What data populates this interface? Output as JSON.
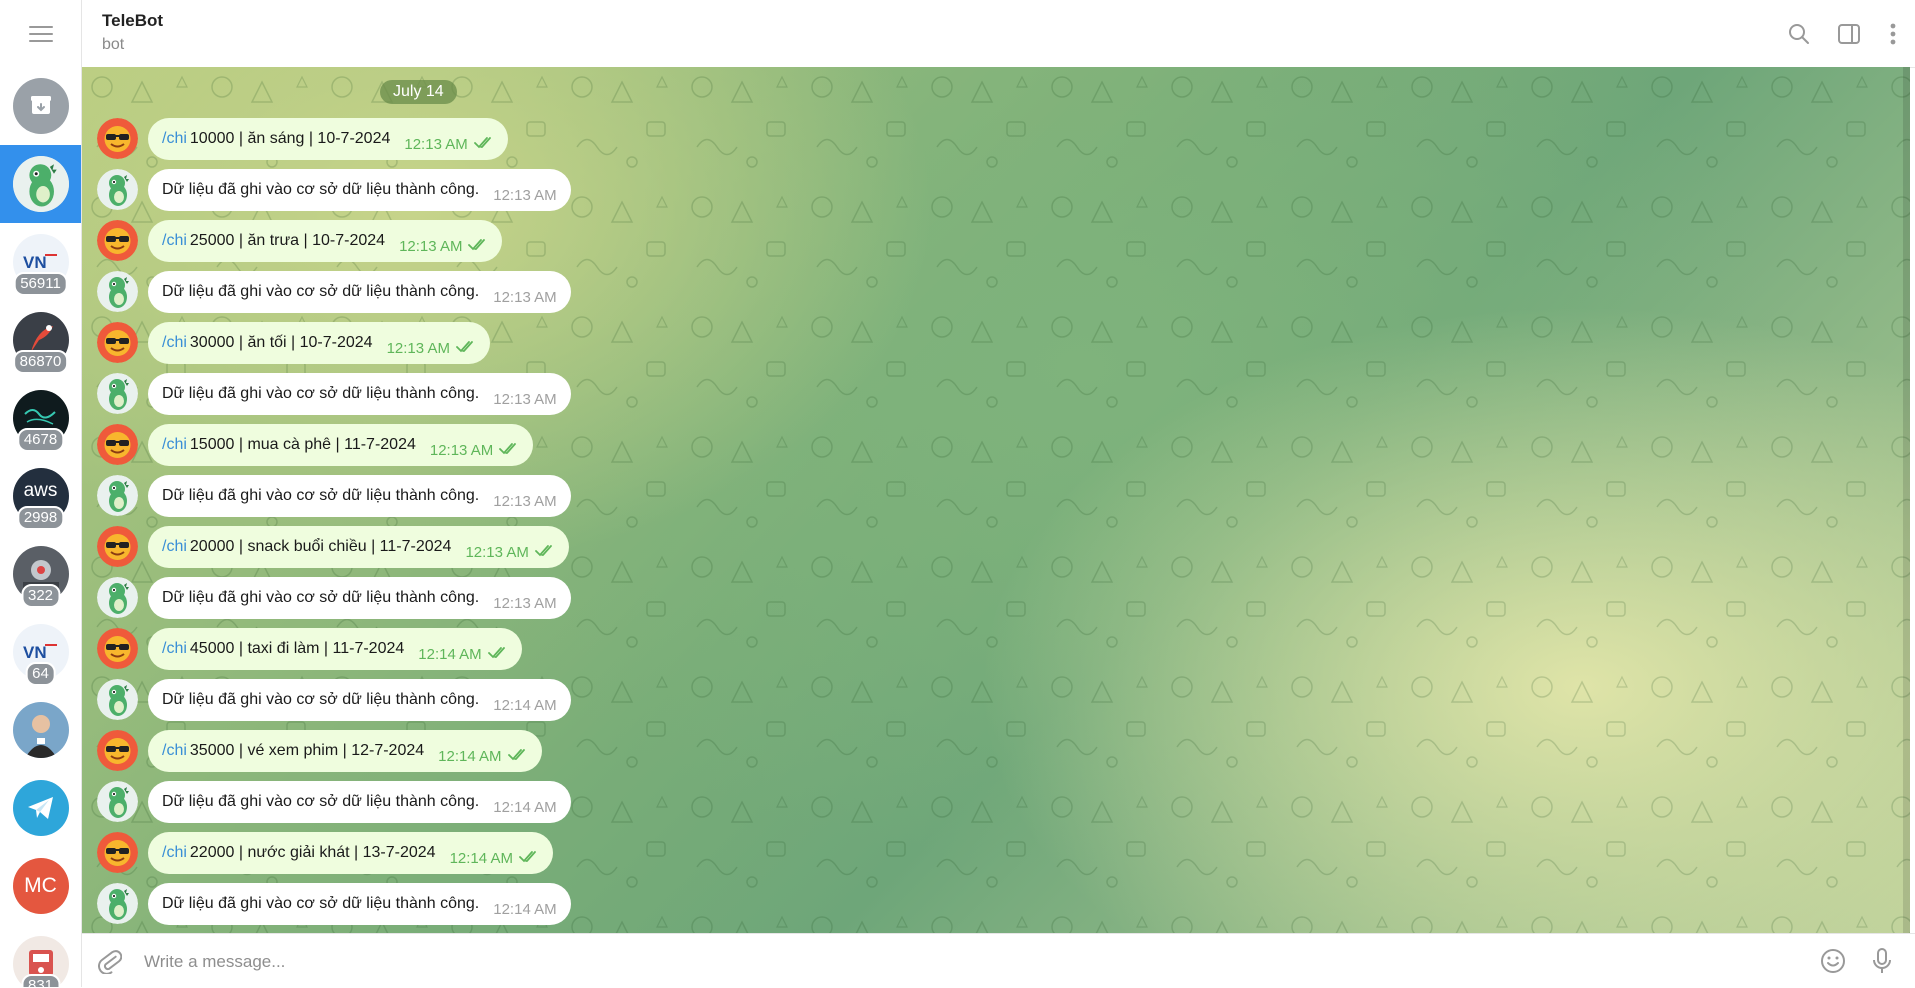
{
  "header": {
    "title": "TeleBot",
    "subtitle": "bot"
  },
  "sidebar": {
    "items": [
      {
        "name": "archive",
        "badge": null
      },
      {
        "name": "telebot",
        "badge": null,
        "active": true
      },
      {
        "name": "chat-vn-1",
        "badge": "56911"
      },
      {
        "name": "chat-bird",
        "badge": "86870"
      },
      {
        "name": "chat-dark",
        "badge": "4678"
      },
      {
        "name": "chat-aws",
        "label": "aws",
        "badge": "2998"
      },
      {
        "name": "chat-photo",
        "badge": "322"
      },
      {
        "name": "chat-vn-2",
        "badge": "64"
      },
      {
        "name": "chat-person",
        "badge": null
      },
      {
        "name": "telegram",
        "badge": null
      },
      {
        "name": "mc",
        "label": "MC",
        "badge": null
      },
      {
        "name": "chat-group",
        "badge": "831"
      }
    ]
  },
  "chat": {
    "date": "July 14",
    "messages": [
      {
        "type": "out",
        "cmd": "/chi",
        "text": "10000 | ăn sáng | 10-7-2024",
        "time": "12:13 AM"
      },
      {
        "type": "in",
        "text": "Dữ liệu đã ghi vào cơ sở dữ liệu thành công.",
        "time": "12:13 AM"
      },
      {
        "type": "out",
        "cmd": "/chi",
        "text": "25000 | ăn trưa | 10-7-2024",
        "time": "12:13 AM"
      },
      {
        "type": "in",
        "text": "Dữ liệu đã ghi vào cơ sở dữ liệu thành công.",
        "time": "12:13 AM"
      },
      {
        "type": "out",
        "cmd": "/chi",
        "text": "30000 | ăn tối | 10-7-2024",
        "time": "12:13 AM"
      },
      {
        "type": "in",
        "text": "Dữ liệu đã ghi vào cơ sở dữ liệu thành công.",
        "time": "12:13 AM"
      },
      {
        "type": "out",
        "cmd": "/chi",
        "text": "15000 | mua cà phê | 11-7-2024",
        "time": "12:13 AM"
      },
      {
        "type": "in",
        "text": "Dữ liệu đã ghi vào cơ sở dữ liệu thành công.",
        "time": "12:13 AM"
      },
      {
        "type": "out",
        "cmd": "/chi",
        "text": "20000 | snack buổi chiều | 11-7-2024",
        "time": "12:13 AM"
      },
      {
        "type": "in",
        "text": "Dữ liệu đã ghi vào cơ sở dữ liệu thành công.",
        "time": "12:13 AM"
      },
      {
        "type": "out",
        "cmd": "/chi",
        "text": "45000 | taxi đi làm | 11-7-2024",
        "time": "12:14 AM"
      },
      {
        "type": "in",
        "text": "Dữ liệu đã ghi vào cơ sở dữ liệu thành công.",
        "time": "12:14 AM"
      },
      {
        "type": "out",
        "cmd": "/chi",
        "text": "35000 | vé xem phim | 12-7-2024",
        "time": "12:14 AM"
      },
      {
        "type": "in",
        "text": "Dữ liệu đã ghi vào cơ sở dữ liệu thành công.",
        "time": "12:14 AM"
      },
      {
        "type": "out",
        "cmd": "/chi",
        "text": "22000 | nước giải khát | 13-7-2024",
        "time": "12:14 AM"
      },
      {
        "type": "in",
        "text": "Dữ liệu đã ghi vào cơ sở dữ liệu thành công.",
        "time": "12:14 AM"
      }
    ]
  },
  "composer": {
    "placeholder": "Write a message..."
  },
  "colors": {
    "accent": "#3390ec",
    "outgoing_bubble": "#effdde",
    "incoming_bubble": "#ffffff",
    "check": "#5fb65a"
  }
}
